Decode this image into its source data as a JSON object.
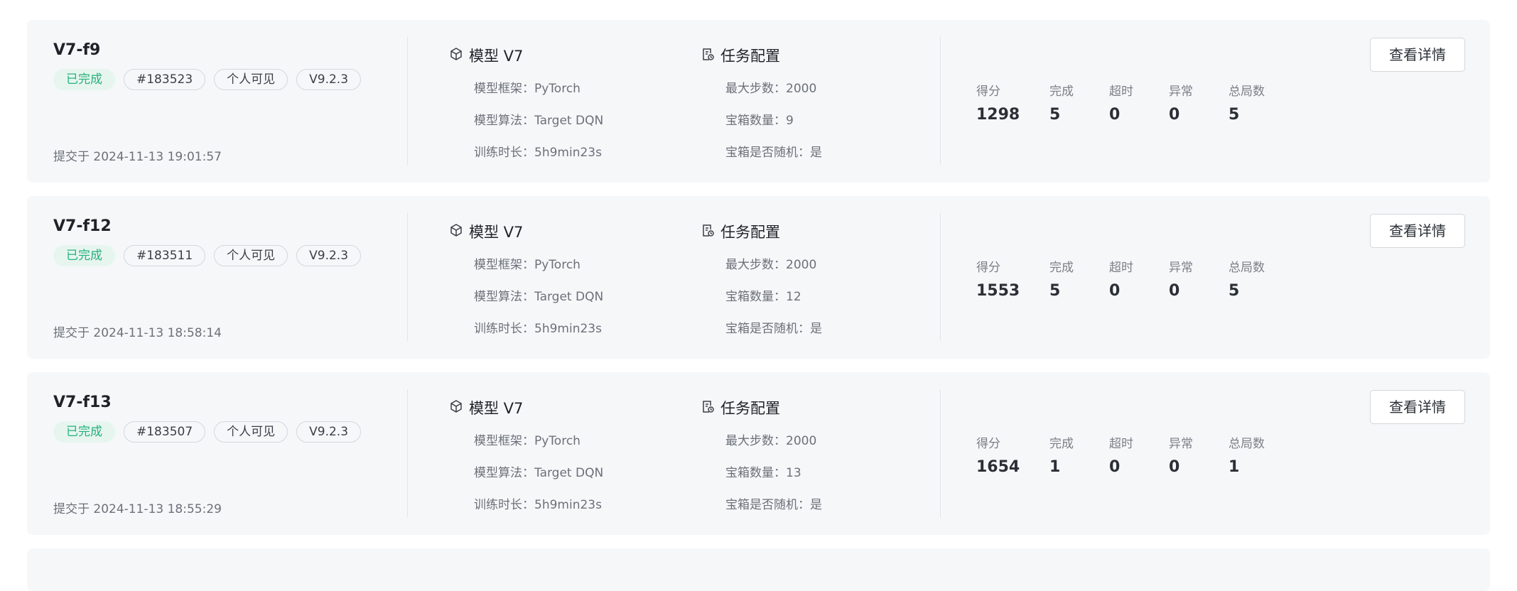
{
  "model_section_label": "模型 V7",
  "task_section_label": "任务配置",
  "detail_button_label": "查看详情",
  "stat_labels": {
    "score": "得分",
    "completed": "完成",
    "timeout": "超时",
    "error": "异常",
    "total": "总局数"
  },
  "cards": [
    {
      "title": "V7-f9",
      "status": "已完成",
      "id": "#183523",
      "visibility": "个人可见",
      "version": "V9.2.3",
      "submitted": "提交于 2024-11-13 19:01:57",
      "framework": "模型框架：PyTorch",
      "algorithm": "模型算法：Target DQN",
      "duration": "训练时长：5h9min23s",
      "max_steps": "最大步数：2000",
      "chest_count": "宝箱数量：9",
      "chest_random": "宝箱是否随机：是",
      "score": "1298",
      "completed": "5",
      "timeout": "0",
      "error": "0",
      "total": "5"
    },
    {
      "title": "V7-f12",
      "status": "已完成",
      "id": "#183511",
      "visibility": "个人可见",
      "version": "V9.2.3",
      "submitted": "提交于 2024-11-13 18:58:14",
      "framework": "模型框架：PyTorch",
      "algorithm": "模型算法：Target DQN",
      "duration": "训练时长：5h9min23s",
      "max_steps": "最大步数：2000",
      "chest_count": "宝箱数量：12",
      "chest_random": "宝箱是否随机：是",
      "score": "1553",
      "completed": "5",
      "timeout": "0",
      "error": "0",
      "total": "5"
    },
    {
      "title": "V7-f13",
      "status": "已完成",
      "id": "#183507",
      "visibility": "个人可见",
      "version": "V9.2.3",
      "submitted": "提交于 2024-11-13 18:55:29",
      "framework": "模型框架：PyTorch",
      "algorithm": "模型算法：Target DQN",
      "duration": "训练时长：5h9min23s",
      "max_steps": "最大步数：2000",
      "chest_count": "宝箱数量：13",
      "chest_random": "宝箱是否随机：是",
      "score": "1654",
      "completed": "1",
      "timeout": "0",
      "error": "0",
      "total": "1"
    }
  ]
}
